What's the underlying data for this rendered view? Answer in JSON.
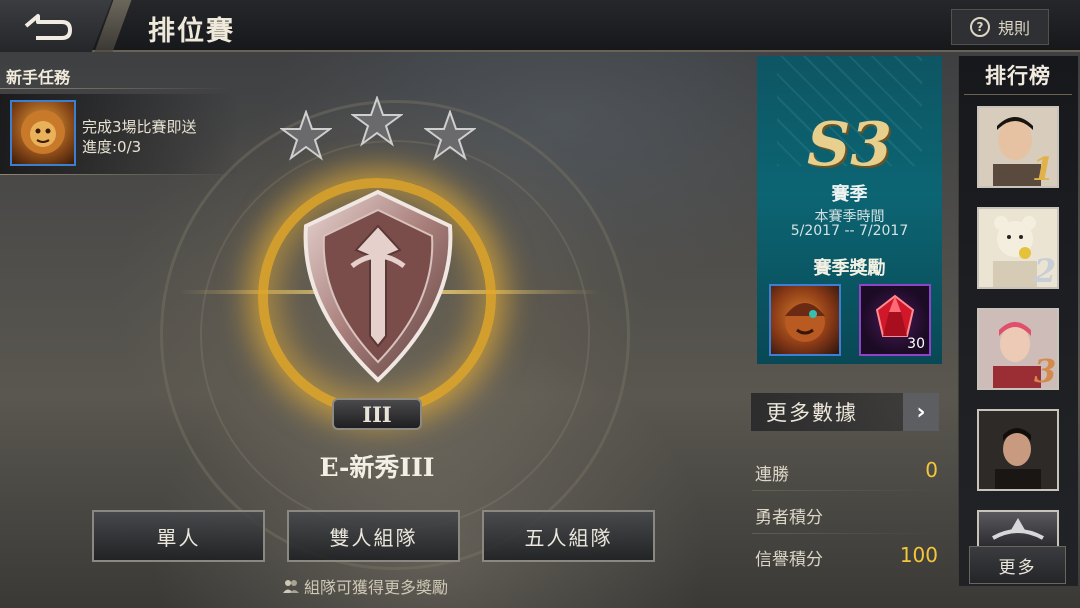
{
  "header": {
    "title": "排位賽",
    "rules_label": "規則",
    "rules_icon": "question-circle-icon",
    "back_icon": "back-arrow-icon"
  },
  "quest": {
    "title": "新手任務",
    "line1": "完成3場比賽即送",
    "line2": "進度:0/3"
  },
  "rank": {
    "stars_total": 3,
    "stars_filled": 0,
    "tier": "III",
    "name": "E-新秀III"
  },
  "modes": [
    {
      "label": "單人"
    },
    {
      "label": "雙人組隊"
    },
    {
      "label": "五人組隊"
    }
  ],
  "team_tip": "組隊可獲得更多獎勵",
  "season": {
    "name": "S3",
    "label": "賽季",
    "time_label": "本賽季時間",
    "time_range": "5/2017 -- 7/2017",
    "rewards_title": "賽季獎勵",
    "reward_items": [
      {
        "type": "hero-skin",
        "icon": "hero-portrait-icon"
      },
      {
        "type": "gem",
        "icon": "red-gem-icon",
        "count": "30"
      }
    ]
  },
  "stats": {
    "more_label": "更多數據",
    "rows": [
      {
        "label": "連勝",
        "value": "0"
      },
      {
        "label": "勇者積分",
        "value": ""
      },
      {
        "label": "信譽積分",
        "value": "100"
      }
    ]
  },
  "leaderboard": {
    "title": "排行榜",
    "entries": [
      {
        "rank": "1"
      },
      {
        "rank": "2"
      },
      {
        "rank": "3"
      },
      {
        "rank": ""
      }
    ],
    "more_label": "更多"
  },
  "colors": {
    "accent_gold": "#f3c738",
    "season_teal": "#0c6573",
    "hero_border_blue": "#3d7ed6",
    "gem_border_purple": "#8c44c8"
  }
}
